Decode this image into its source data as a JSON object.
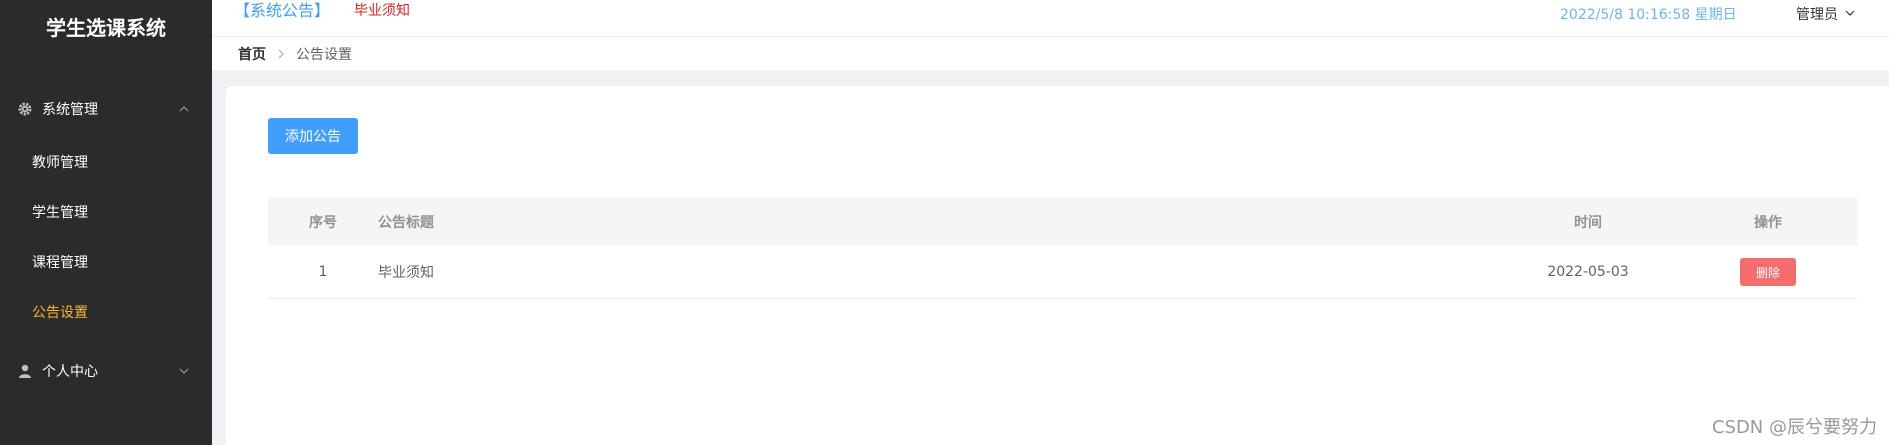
{
  "app": {
    "title": "学生选课系统"
  },
  "sidebar": {
    "groups": [
      {
        "label": "系统管理",
        "icon": "gear-icon",
        "expanded": true,
        "items": [
          {
            "label": "教师管理"
          },
          {
            "label": "学生管理"
          },
          {
            "label": "课程管理"
          },
          {
            "label": "公告设置",
            "active": true
          }
        ]
      },
      {
        "label": "个人中心",
        "icon": "user-icon",
        "expanded": false
      }
    ]
  },
  "header": {
    "notice_tag": "【系统公告】",
    "notice_text": "毕业须知",
    "datetime": "2022/5/8 10:16:58 星期日",
    "user_label": "管理员"
  },
  "breadcrumb": {
    "home": "首页",
    "current": "公告设置"
  },
  "main": {
    "add_button": "添加公告",
    "table": {
      "headers": {
        "index": "序号",
        "title": "公告标题",
        "time": "时间",
        "action": "操作"
      },
      "rows": [
        {
          "index": "1",
          "title": "毕业须知",
          "time": "2022-05-03",
          "delete_label": "删除"
        }
      ]
    }
  },
  "watermark": "CSDN @辰兮要努力",
  "colors": {
    "primary": "#409eff",
    "danger": "#f56c6c",
    "sidebar_bg": "#2b2b2b",
    "active_menu": "#f5b731",
    "notice_red": "#e02020"
  }
}
